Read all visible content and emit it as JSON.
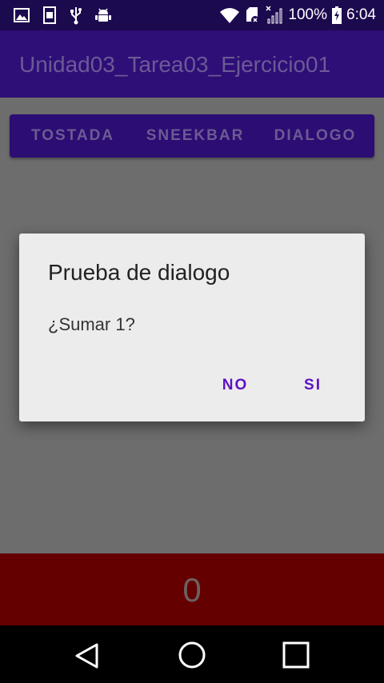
{
  "status_bar": {
    "battery_percent": "100%",
    "time": "6:04",
    "left_icons": [
      "image-icon",
      "storage-icon",
      "usb-icon",
      "android-debug-icon"
    ],
    "right_icons": [
      "wifi-icon",
      "sd-card-icon",
      "no-signal-icon",
      "battery-charging-icon"
    ]
  },
  "app_bar": {
    "title": "Unidad03_Tarea03_Ejercicio01"
  },
  "buttons": {
    "tostada": "TOSTADA",
    "sneekbar": "SNEEKBAR",
    "dialogo": "DIALOGO"
  },
  "counter": {
    "value": "0"
  },
  "dialog": {
    "title": "Prueba de dialogo",
    "message": "¿Sumar 1?",
    "negative_label": "NO",
    "positive_label": "SI"
  },
  "nav_bar": {
    "icons": [
      "back-icon",
      "home-icon",
      "recents-icon"
    ]
  },
  "colors": {
    "status_bar": "#1c0a4e",
    "app_bar": "#2e0e77",
    "button_bar": "#2c0d73",
    "counter_bar": "#650000",
    "dialog_accent": "#5d12c4",
    "scrim_background": "#6d6d6d"
  }
}
